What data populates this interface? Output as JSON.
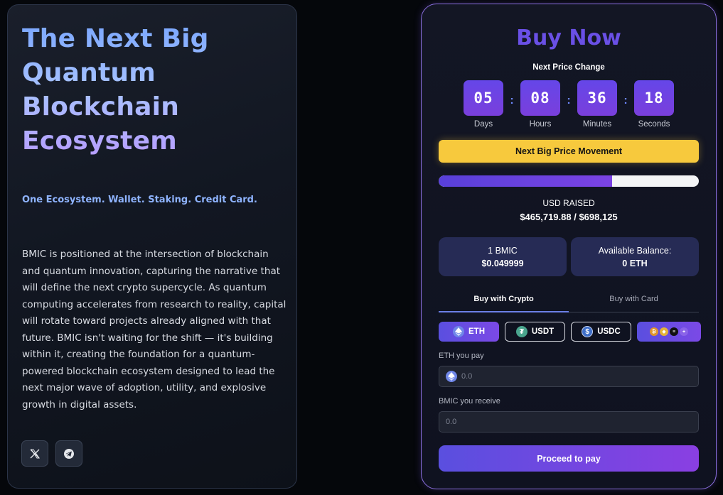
{
  "hero": {
    "title_lines": [
      "The Next Big",
      "Quantum",
      "Blockchain",
      "Ecosystem"
    ],
    "tagline": "One Ecosystem. Wallet. Staking. Credit Card.",
    "description": "BMIC is positioned at the intersection of blockchain and quantum innovation, capturing the narrative that will define the next crypto supercycle. As quantum computing accelerates from research to reality, capital will rotate toward projects already aligned with that future. BMIC isn't waiting for the shift — it's building within it, creating the foundation for a quantum-powered blockchain ecosystem designed to lead the next major wave of adoption, utility, and explosive growth in digital assets.",
    "social": [
      {
        "icon": "x-twitter-icon"
      },
      {
        "icon": "telegram-icon"
      }
    ]
  },
  "buy": {
    "title": "Buy Now",
    "next_price_change": "Next Price Change",
    "countdown": {
      "days": "05",
      "hours": "08",
      "minutes": "36",
      "seconds": "18",
      "days_label": "Days",
      "hours_label": "Hours",
      "minutes_label": "Minutes",
      "seconds_label": "Seconds",
      "separator": ":"
    },
    "movement_label": "Next Big Price Movement",
    "progress_fraction": 0.666,
    "raised_label": "USD RAISED",
    "raised_value": "$465,719.88 / $698,125",
    "price_card": {
      "line1": "1 BMIC",
      "line2": "$0.049999"
    },
    "balance_card": {
      "line1": "Available Balance:",
      "line2": "0 ETH"
    },
    "tabs": [
      {
        "label": "Buy with Crypto",
        "active": true
      },
      {
        "label": "Buy with Card",
        "active": false
      }
    ],
    "tokens": {
      "eth": "ETH",
      "usdt": "USDT",
      "usdc": "USDC"
    },
    "pay_field": {
      "label": "ETH you pay",
      "placeholder": "0.0"
    },
    "receive_field": {
      "label": "BMIC you receive",
      "placeholder": "0.0"
    },
    "proceed_label": "Proceed to pay",
    "colors": {
      "accent": "#6a50e6",
      "yellow": "#f7c93d",
      "card_bg": "#262b55"
    }
  }
}
